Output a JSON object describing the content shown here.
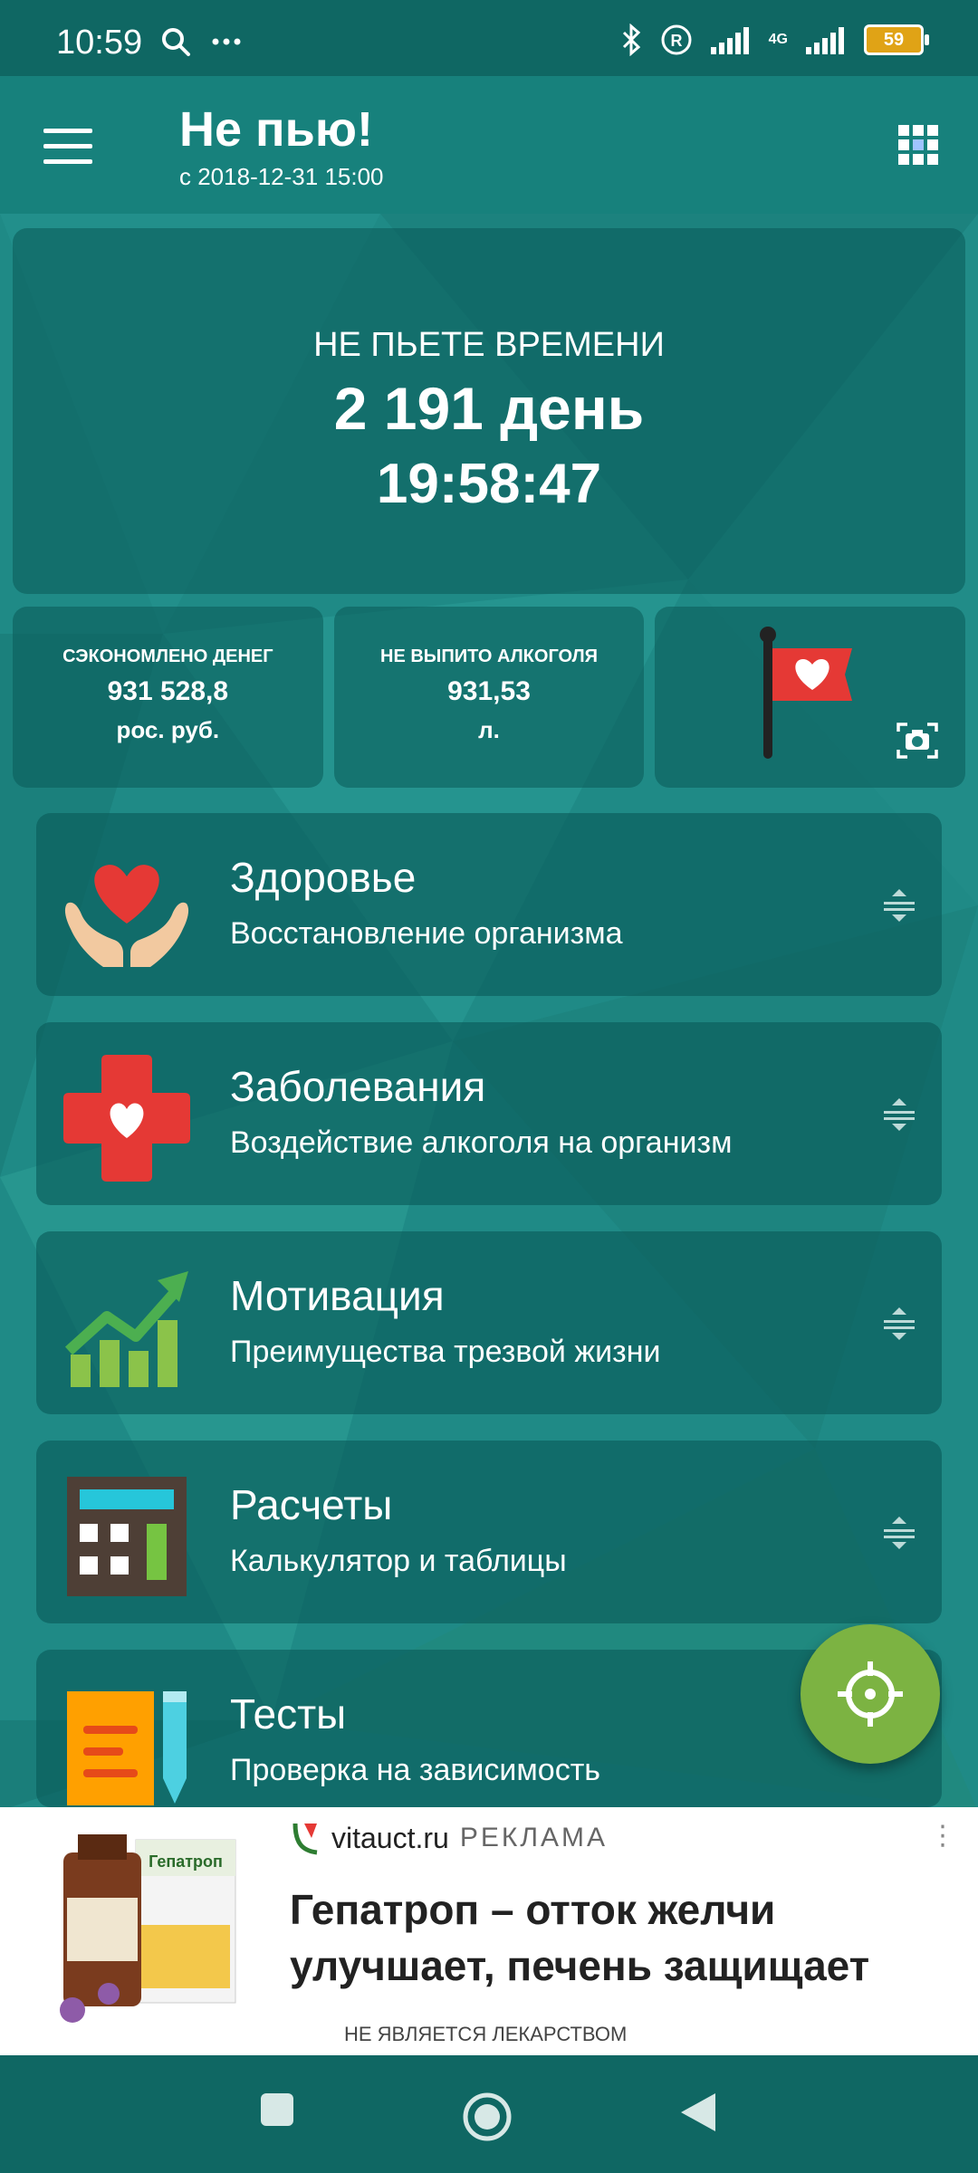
{
  "status_bar": {
    "time": "10:59",
    "network": "4G",
    "battery": "59"
  },
  "app_bar": {
    "title": "Не пью!",
    "subtitle": "с 2018-12-31 15:00"
  },
  "timer": {
    "label": "НЕ ПЬЕТЕ ВРЕМЕНИ",
    "days": "2 191 день",
    "clock": "19:58:47"
  },
  "stats": [
    {
      "label": "СЭКОНОМЛЕНО ДЕНЕГ",
      "value": "931 528,8",
      "unit": "рос. руб."
    },
    {
      "label": "НЕ ВЫПИТО АЛКОГОЛЯ",
      "value": "931,53",
      "unit": "л."
    }
  ],
  "menu": [
    {
      "title": "Здоровье",
      "subtitle": "Восстановление организма",
      "icon": "heart-hands-icon"
    },
    {
      "title": "Заболевания",
      "subtitle": "Воздействие алкоголя на организм",
      "icon": "medical-cross-icon"
    },
    {
      "title": "Мотивация",
      "subtitle": "Преимущества трезвой жизни",
      "icon": "growth-chart-icon"
    },
    {
      "title": "Расчеты",
      "subtitle": "Калькулятор и таблицы",
      "icon": "calculator-icon"
    },
    {
      "title": "Тесты",
      "subtitle": "Проверка на зависимость",
      "icon": "test-notepad-icon"
    }
  ],
  "ad": {
    "domain": "vitauct.ru",
    "label": "РЕКЛАМА",
    "headline": "Гепатроп – отток желчи улучшает, печень защищает",
    "disclaimer": "НЕ ЯВЛЯЕТСЯ ЛЕКАРСТВОМ",
    "product_box_text": "Гепатроп"
  },
  "colors": {
    "primary": "#17817c",
    "status_bar": "#0f6763",
    "fab": "#7cb342",
    "heart_red": "#e53935"
  }
}
